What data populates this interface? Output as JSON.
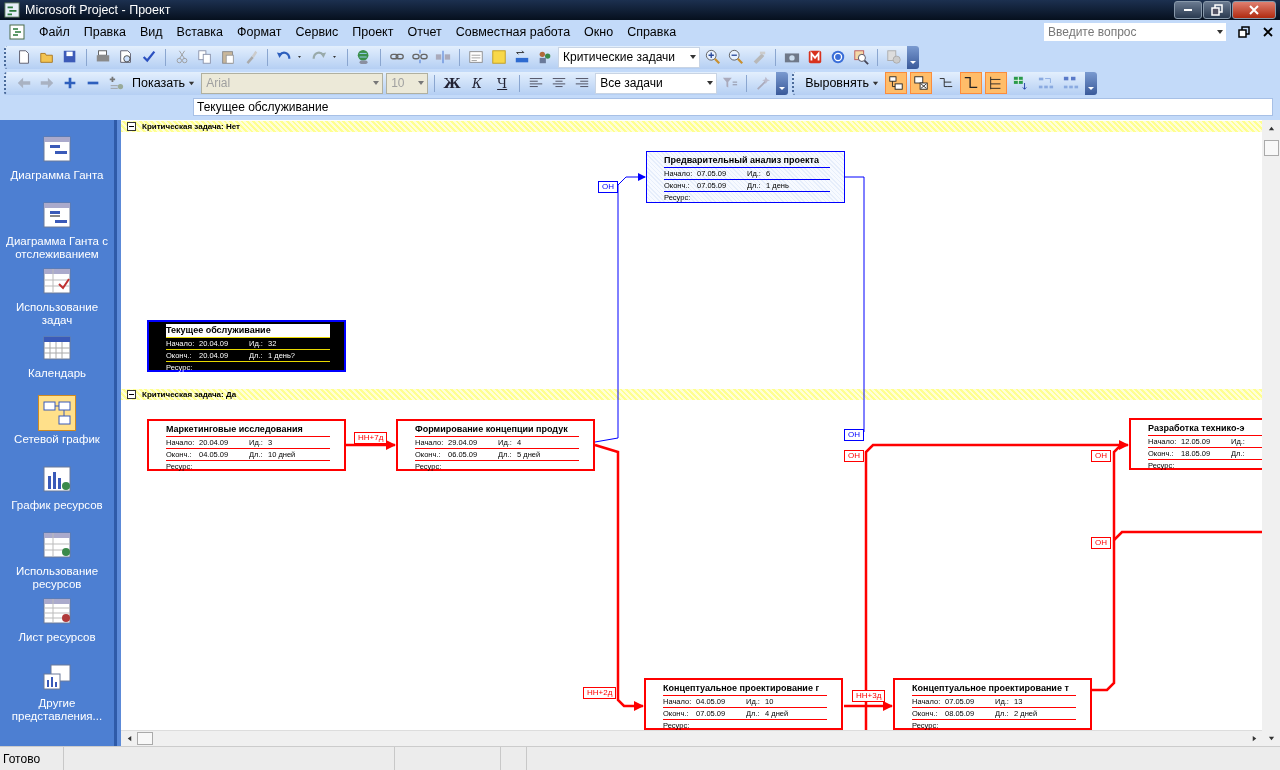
{
  "window": {
    "title": "Microsoft Project - Проект"
  },
  "menu": [
    {
      "label": "Файл"
    },
    {
      "label": "Правка"
    },
    {
      "label": "Вид"
    },
    {
      "label": "Вставка"
    },
    {
      "label": "Формат"
    },
    {
      "label": "Сервис"
    },
    {
      "label": "Проект"
    },
    {
      "label": "Отчет"
    },
    {
      "label": "Совместная работа"
    },
    {
      "label": "Окно"
    },
    {
      "label": "Справка"
    }
  ],
  "help_box": {
    "placeholder": "Введите вопрос"
  },
  "toolbar_standard": {
    "view_combo": "Критические задачи"
  },
  "toolbar_format": {
    "show_button": "Показать",
    "font_combo": {
      "value": "Arial",
      "disabled": true
    },
    "size_combo": {
      "value": "10",
      "disabled": true
    },
    "format_buttons": [
      {
        "label": "Ж",
        "kind": "bold"
      },
      {
        "label": "К",
        "kind": "italic"
      },
      {
        "label": "Ч",
        "kind": "underline"
      }
    ],
    "filter_combo": "Все задачи"
  },
  "toolbar_layout": {
    "align_button": "Выровнять",
    "toggles": [
      {
        "selected": true
      },
      {
        "selected": true
      },
      {
        "selected": false
      },
      {
        "selected": true
      },
      {
        "selected": true
      },
      {
        "selected": false
      },
      {
        "selected": false
      },
      {
        "selected": false
      }
    ]
  },
  "entry_bar": {
    "value": "Текущее обслуживание"
  },
  "sidebar": {
    "items": [
      {
        "label": "Диаграмма Ганта",
        "selected": false
      },
      {
        "label": "Диаграмма Ганта с отслеживанием",
        "selected": false
      },
      {
        "label": "Использование задач",
        "selected": false
      },
      {
        "label": "Календарь",
        "selected": false
      },
      {
        "label": "Сетевой график",
        "selected": true
      },
      {
        "label": "График ресурсов",
        "selected": false
      },
      {
        "label": "Использование ресурсов",
        "selected": false
      },
      {
        "label": "Лист ресурсов",
        "selected": false
      },
      {
        "label": "Другие представления...",
        "selected": false
      }
    ]
  },
  "groups": [
    {
      "label": "Критическая задача: Нет"
    },
    {
      "label": "Критическая задача: Да"
    }
  ],
  "nodes": [
    {
      "title": "Предварительный анализ проекта",
      "critical": false,
      "selected": false,
      "rows": [
        [
          {
            "label": "Начало:",
            "value": "07.05.09"
          },
          {
            "label": "Ид.:",
            "value": "6"
          }
        ],
        [
          {
            "label": "Оконч.:",
            "value": "07.05.09"
          },
          {
            "label": "Дл.:",
            "value": "1 день"
          }
        ],
        [
          {
            "label": "Ресурс:"
          }
        ]
      ]
    },
    {
      "title": "Текущее обслуживание",
      "critical": false,
      "selected": true,
      "rows": [
        [
          {
            "label": "Начало:",
            "value": "20.04.09"
          },
          {
            "label": "Ид.:",
            "value": "32"
          }
        ],
        [
          {
            "label": "Оконч.:",
            "value": "20.04.09"
          },
          {
            "label": "Дл.:",
            "value": "1 день?"
          }
        ],
        [
          {
            "label": "Ресурс:"
          }
        ]
      ]
    },
    {
      "title": "Маркетинговые исследования",
      "critical": true,
      "selected": false,
      "rows": [
        [
          {
            "label": "Начало:",
            "value": "20.04.09"
          },
          {
            "label": "Ид.:",
            "value": "3"
          }
        ],
        [
          {
            "label": "Оконч.:",
            "value": "04.05.09"
          },
          {
            "label": "Дл.:",
            "value": "10 дней"
          }
        ],
        [
          {
            "label": "Ресурс:"
          }
        ]
      ]
    },
    {
      "title": "Формирование концепции продук",
      "critical": true,
      "selected": false,
      "rows": [
        [
          {
            "label": "Начало:",
            "value": "29.04.09"
          },
          {
            "label": "Ид.:",
            "value": "4"
          }
        ],
        [
          {
            "label": "Оконч.:",
            "value": "06.05.09"
          },
          {
            "label": "Дл.:",
            "value": "5 дней"
          }
        ],
        [
          {
            "label": "Ресурс:"
          }
        ]
      ]
    },
    {
      "title": "Разработка технико-э",
      "critical": true,
      "selected": false,
      "rows": [
        [
          {
            "label": "Начало:",
            "value": "12.05.09"
          },
          {
            "label": "Ид.:"
          }
        ],
        [
          {
            "label": "Оконч.:",
            "value": "18.05.09"
          },
          {
            "label": "Дл.:"
          }
        ],
        [
          {
            "label": "Ресурс:"
          }
        ]
      ]
    },
    {
      "title": "Концептуальное проектирование г",
      "critical": true,
      "selected": false,
      "rows": [
        [
          {
            "label": "Начало:",
            "value": "04.05.09"
          },
          {
            "label": "Ид.:",
            "value": "10"
          }
        ],
        [
          {
            "label": "Оконч.:",
            "value": "07.05.09"
          },
          {
            "label": "Дл.:",
            "value": "4 дней"
          }
        ],
        [
          {
            "label": "Ресурс:"
          }
        ]
      ]
    },
    {
      "title": "Концептуальное проектирование т",
      "critical": true,
      "selected": false,
      "rows": [
        [
          {
            "label": "Начало:",
            "value": "07.05.09"
          },
          {
            "label": "Ид.:",
            "value": "13"
          }
        ],
        [
          {
            "label": "Оконч.:",
            "value": "08.05.09"
          },
          {
            "label": "Дл.:",
            "value": "2 дней"
          }
        ],
        [
          {
            "label": "Ресурс:"
          }
        ]
      ]
    }
  ],
  "link_labels": [
    {
      "label": "ОН",
      "critical": false
    },
    {
      "label": "НН+7д",
      "critical": true
    },
    {
      "label": "ОН",
      "critical": false
    },
    {
      "label": "ОН",
      "critical": true
    },
    {
      "label": "ОН",
      "critical": true
    },
    {
      "label": "ОН",
      "critical": true
    },
    {
      "label": "НН+2д",
      "critical": true
    },
    {
      "label": "НН+3д",
      "critical": true
    }
  ],
  "status_bar": {
    "text": "Готово"
  }
}
